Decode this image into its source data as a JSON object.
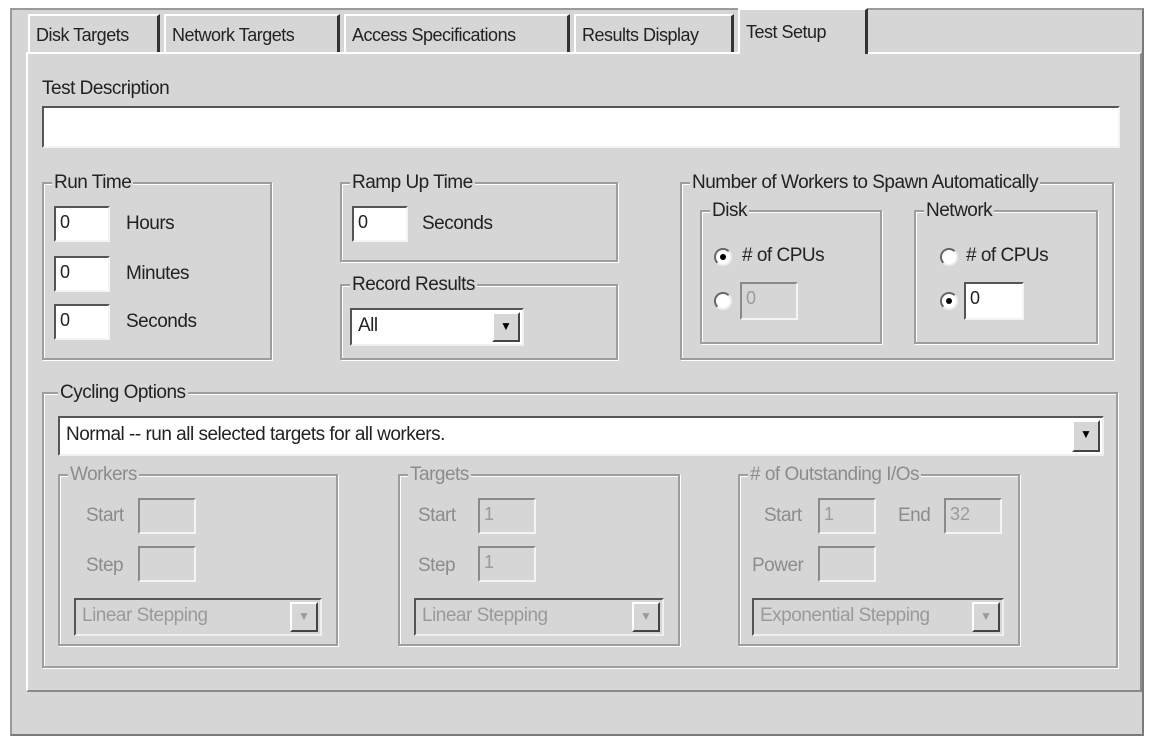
{
  "tabs": [
    "Disk Targets",
    "Network Targets",
    "Access Specifications",
    "Results Display",
    "Test Setup"
  ],
  "active_tab": "Test Setup",
  "test_description": {
    "label": "Test Description",
    "value": ""
  },
  "run_time": {
    "title": "Run Time",
    "hours": {
      "value": "0",
      "unit": "Hours"
    },
    "minutes": {
      "value": "0",
      "unit": "Minutes"
    },
    "seconds": {
      "value": "0",
      "unit": "Seconds"
    }
  },
  "ramp_up": {
    "title": "Ramp Up Time",
    "value": "0",
    "unit": "Seconds"
  },
  "record_results": {
    "title": "Record Results",
    "selected": "All"
  },
  "workers_spawn": {
    "title": "Number of Workers to Spawn Automatically",
    "disk": {
      "title": "Disk",
      "cpus_label": "# of CPUs",
      "count_value": "0",
      "selected": "cpus"
    },
    "network": {
      "title": "Network",
      "cpus_label": "# of CPUs",
      "count_value": "0",
      "selected": "count"
    }
  },
  "cycling": {
    "title": "Cycling Options",
    "selected": "Normal -- run all selected targets for all workers.",
    "workers": {
      "title": "Workers",
      "start_label": "Start",
      "step_label": "Step",
      "start_value": "",
      "step_value": "",
      "stepping": "Linear Stepping"
    },
    "targets": {
      "title": "Targets",
      "start_label": "Start",
      "step_label": "Step",
      "start_value": "1",
      "step_value": "1",
      "stepping": "Linear Stepping"
    },
    "ios": {
      "title": "# of Outstanding I/Os",
      "start_label": "Start",
      "end_label": "End",
      "power_label": "Power",
      "start_value": "1",
      "end_value": "32",
      "power_value": "",
      "stepping": "Exponential Stepping"
    }
  }
}
